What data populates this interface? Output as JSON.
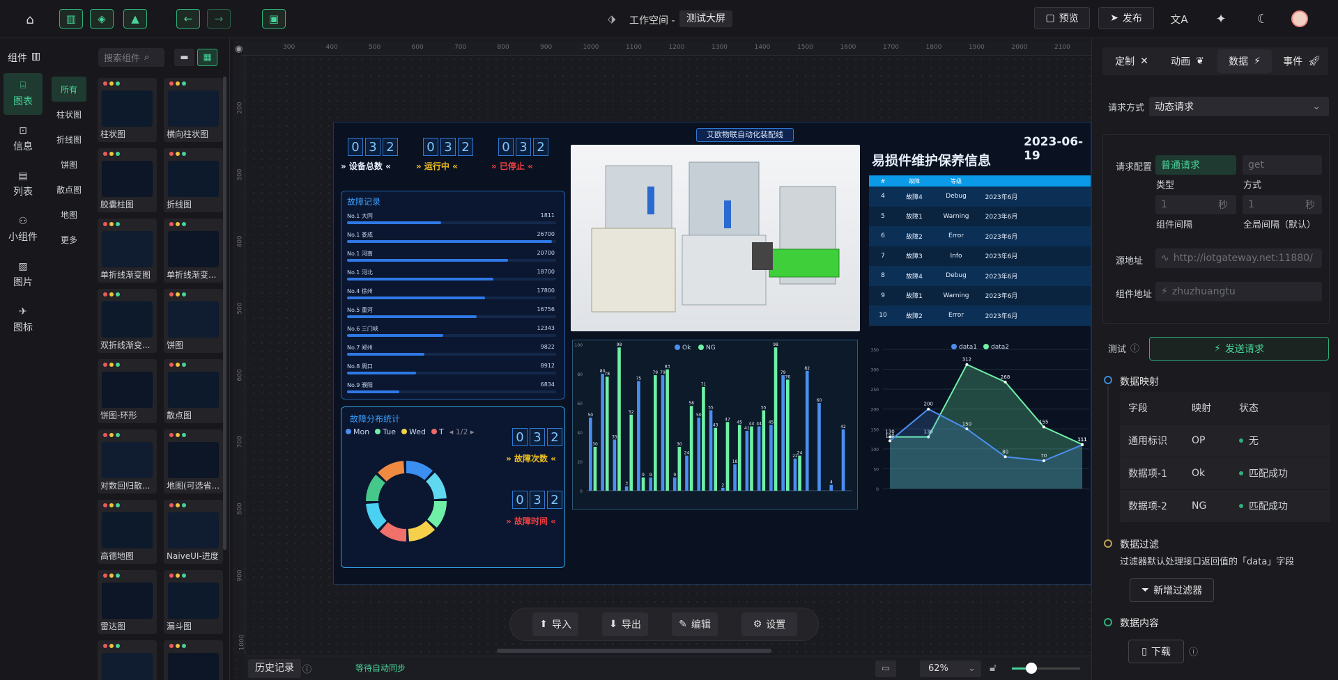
{
  "topbar": {
    "title_prefix": "工作空间 -",
    "title": "测试大屏",
    "preview": "预览",
    "publish": "发布"
  },
  "left": {
    "header": "组件",
    "search_placeholder": "搜索组件",
    "nav": [
      "图表",
      "信息",
      "列表",
      "小组件",
      "图片",
      "图标"
    ],
    "sub": [
      "所有",
      "柱状图",
      "折线图",
      "饼图",
      "散点图",
      "地图",
      "更多"
    ],
    "cards": [
      "柱状图",
      "横向柱状图",
      "胶囊柱图",
      "折线图",
      "单折线渐变图",
      "单折线渐变...",
      "双折线渐变...",
      "饼图",
      "饼图-环形",
      "散点图",
      "对数回归散...",
      "地图(可选省...",
      "高德地图",
      "NaiveUI-进度",
      "雷达图",
      "漏斗图",
      "",
      ""
    ]
  },
  "screen": {
    "banner": "艾欧物联自动化装配线",
    "date": "2023-06-19",
    "digits": [
      "0",
      "3",
      "2"
    ],
    "kpi_labels": [
      "设备总数",
      "运行中",
      "已停止"
    ],
    "fault_title": "故障记录",
    "fault_rows": [
      {
        "label": "No.1 大同",
        "value": "1811",
        "pct": 0.45
      },
      {
        "label": "No.1 娄成",
        "value": "26700",
        "pct": 0.98
      },
      {
        "label": "No.1 河南",
        "value": "20700",
        "pct": 0.77
      },
      {
        "label": "No.1 河北",
        "value": "18700",
        "pct": 0.7
      },
      {
        "label": "No.4 徐州",
        "value": "17800",
        "pct": 0.66
      },
      {
        "label": "No.5 重河",
        "value": "16756",
        "pct": 0.62
      },
      {
        "label": "No.6 三门峡",
        "value": "12343",
        "pct": 0.46
      },
      {
        "label": "No.7 郑州",
        "value": "9822",
        "pct": 0.37
      },
      {
        "label": "No.8 周口",
        "value": "8912",
        "pct": 0.33
      },
      {
        "label": "No.9 濮阳",
        "value": "6834",
        "pct": 0.25
      }
    ],
    "dist_title": "故障分布统计",
    "dist_legend": [
      "Mon",
      "Tue",
      "Wed",
      "T"
    ],
    "dist_page": "1/2",
    "fault_count": "故障次数",
    "fault_time": "故障时间",
    "maint_title": "易损件维护保养信息",
    "maint_head": [
      "#",
      "故障",
      "等级",
      ""
    ],
    "maint_rows": [
      [
        "4",
        "故障4",
        "Debug",
        "2023年6月"
      ],
      [
        "5",
        "故障1",
        "Warning",
        "2023年6月"
      ],
      [
        "6",
        "故障2",
        "Error",
        "2023年6月"
      ],
      [
        "7",
        "故障3",
        "Info",
        "2023年6月"
      ],
      [
        "8",
        "故障4",
        "Debug",
        "2023年6月"
      ],
      [
        "9",
        "故障1",
        "Warning",
        "2023年6月"
      ],
      [
        "10",
        "故障2",
        "Error",
        "2023年6月"
      ]
    ]
  },
  "chart_data": [
    {
      "type": "bar",
      "legend": [
        "Ok",
        "NG"
      ],
      "ylim": [
        0,
        100
      ],
      "yticks": [
        "0",
        "20",
        "40",
        "60",
        "80",
        "100"
      ],
      "series": [
        {
          "name": "Ok",
          "values": [
            50,
            80,
            35,
            3,
            75,
            9,
            79,
            9,
            24,
            50,
            55,
            2,
            18,
            41,
            44,
            45,
            79,
            22,
            82,
            60,
            4,
            42
          ]
        },
        {
          "name": "NG",
          "values": [
            30,
            78,
            98,
            52,
            9,
            79,
            83,
            30,
            58,
            71,
            43,
            47,
            45,
            44,
            55,
            98,
            76,
            24,
            0,
            0,
            0,
            0
          ]
        }
      ],
      "colors": {
        "Ok": "#4a8ff0",
        "NG": "#6ff0a6"
      }
    },
    {
      "type": "line",
      "legend": [
        "data1",
        "data2"
      ],
      "ylim": [
        0,
        350
      ],
      "yticks": [
        "0",
        "50",
        "100",
        "150",
        "200",
        "250",
        "300",
        "350"
      ],
      "series": [
        {
          "name": "data1",
          "values": [
            120,
            200,
            150,
            80,
            70,
            110
          ]
        },
        {
          "name": "data2",
          "values": [
            130,
            130,
            312,
            268,
            155,
            111
          ]
        }
      ],
      "labels_data1": [
        "120",
        "200",
        "150",
        "80",
        "70",
        "111"
      ],
      "labels_data2": [
        "130",
        "130",
        "312",
        "268",
        "155",
        "111"
      ]
    }
  ],
  "dock": {
    "import": "导入",
    "export": "导出",
    "edit": "编辑",
    "settings": "设置"
  },
  "bottom": {
    "history": "历史记录",
    "sync": "等待自动同步",
    "zoom": "62%"
  },
  "right": {
    "tabs": [
      "定制",
      "动画",
      "数据",
      "事件"
    ],
    "request_method_label": "请求方式",
    "request_method": "动态请求",
    "req_config_label": "请求配置",
    "req_type_value": "普通请求",
    "req_method_value": "get",
    "type_label": "类型",
    "method_label": "方式",
    "interval_placeholder": "1",
    "interval_unit": "秒",
    "comp_interval_label": "组件间隔",
    "global_interval_label": "全局间隔（默认）",
    "source_label": "源地址",
    "source_value": "http://iotgateway.net:11880/",
    "comp_addr_label": "组件地址",
    "comp_addr_value": "zhuzhuangtu",
    "test_label": "测试",
    "send_request": "发送请求",
    "mapping_title": "数据映射",
    "mapping_head": [
      "字段",
      "映射",
      "状态"
    ],
    "mapping_rows": [
      [
        "通用标识",
        "OP",
        "无"
      ],
      [
        "数据项-1",
        "Ok",
        "匹配成功"
      ],
      [
        "数据项-2",
        "NG",
        "匹配成功"
      ]
    ],
    "filter_title": "数据过滤",
    "filter_desc": "过滤器默认处理接口返回值的「data」字段",
    "add_filter": "新增过滤器",
    "content_title": "数据内容",
    "download": "下载"
  },
  "ruler": [
    "300",
    "400",
    "500",
    "600",
    "700",
    "800",
    "900",
    "1000",
    "1100",
    "1200",
    "1300",
    "1400",
    "1500",
    "1600",
    "1700",
    "1800",
    "1900",
    "2000",
    "2100"
  ],
  "vruler": [
    "200",
    "300",
    "400",
    "500",
    "600",
    "700",
    "800",
    "900",
    "1000"
  ]
}
